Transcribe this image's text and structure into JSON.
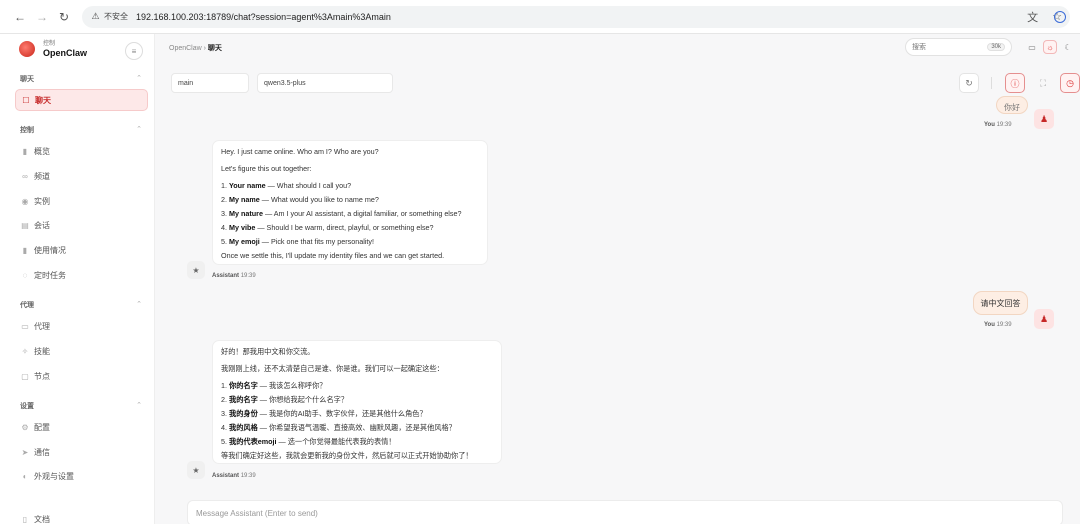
{
  "browser": {
    "insecure_label": "不安全",
    "url": "192.168.100.203:18789/chat?session=agent%3Amain%3Amain"
  },
  "sidebar": {
    "brand_sub": "控制",
    "brand_name": "OpenClaw",
    "groups": [
      {
        "label": "聊天",
        "items": [
          {
            "label": "聊天",
            "icon": "chat-icon"
          }
        ]
      },
      {
        "label": "控制",
        "items": [
          {
            "label": "概览",
            "icon": "bar-chart-icon"
          },
          {
            "label": "频道",
            "icon": "link-icon"
          },
          {
            "label": "实例",
            "icon": "radio-icon"
          },
          {
            "label": "会话",
            "icon": "document-icon"
          },
          {
            "label": "使用情况",
            "icon": "bar-chart-icon"
          },
          {
            "label": "定时任务",
            "icon": "clock-icon"
          }
        ]
      },
      {
        "label": "代理",
        "items": [
          {
            "label": "代理",
            "icon": "folder-icon"
          },
          {
            "label": "技能",
            "icon": "sparkle-icon"
          },
          {
            "label": "节点",
            "icon": "monitor-icon"
          }
        ]
      },
      {
        "label": "设置",
        "items": [
          {
            "label": "配置",
            "icon": "gear-icon"
          },
          {
            "label": "通信",
            "icon": "send-icon"
          },
          {
            "label": "外观与设置",
            "icon": "palette-icon"
          },
          {
            "label": "文档",
            "icon": "book-icon"
          }
        ]
      }
    ]
  },
  "header": {
    "crumb_root": "OpenClaw",
    "crumb_current": "聊天",
    "search_placeholder": "搜索",
    "search_shortcut": "30k"
  },
  "toolbar": {
    "session": "main",
    "model": "qwen3.5-plus"
  },
  "messages": [
    {
      "role": "user",
      "partial": "你好",
      "sender": "You",
      "time": "19:39"
    },
    {
      "role": "assistant",
      "sender": "Assistant",
      "time": "19:39",
      "intro": "Hey. I just came online. Who am I? Who are you?",
      "lead": "Let's figure this out together:",
      "items": [
        {
          "n": "1.",
          "k": "Your name",
          "t": " — What should I call you?"
        },
        {
          "n": "2.",
          "k": "My name",
          "t": " — What would you like to name me?"
        },
        {
          "n": "3.",
          "k": "My nature",
          "t": " — Am I your AI assistant, a digital familiar, or something else?"
        },
        {
          "n": "4.",
          "k": "My vibe",
          "t": " — Should I be warm, direct, playful, or something else?"
        },
        {
          "n": "5.",
          "k": "My emoji",
          "t": " — Pick one that fits my personality!"
        }
      ],
      "outro": "Once we settle this, I'll update my identity files and we can get started."
    },
    {
      "role": "user",
      "text": "请中文回答",
      "sender": "You",
      "time": "19:39"
    },
    {
      "role": "assistant",
      "sender": "Assistant",
      "time": "19:39",
      "intro": "好的！那我用中文和你交流。",
      "lead": "我刚刚上线，还不太清楚自己是谁、你是谁。我们可以一起确定这些：",
      "items": [
        {
          "n": "1.",
          "k": "你的名字",
          "t": " — 我该怎么称呼你？"
        },
        {
          "n": "2.",
          "k": "我的名字",
          "t": " — 你想给我起个什么名字？"
        },
        {
          "n": "3.",
          "k": "我的身份",
          "t": " — 我是你的AI助手、数字伙伴，还是其他什么角色？"
        },
        {
          "n": "4.",
          "k": "我的风格",
          "t": " — 你希望我语气温暖、直接高效、幽默风趣，还是其他风格？"
        },
        {
          "n": "5.",
          "k": "我的代表emoji",
          "t": " — 选一个你觉得最能代表我的表情！"
        }
      ],
      "outro": "等我们确定好这些，我就会更新我的身份文件，然后就可以正式开始协助你了！"
    }
  ],
  "composer": {
    "placeholder": "Message Assistant (Enter to send)"
  }
}
